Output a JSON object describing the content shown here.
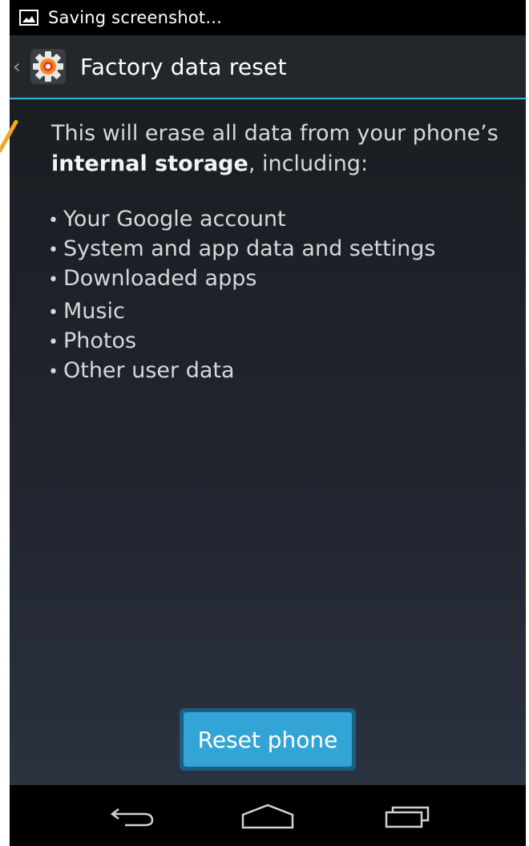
{
  "status_bar": {
    "text": "Saving screenshot...",
    "icon": "image-icon"
  },
  "action_bar": {
    "back_icon": "chevron-left-icon",
    "app_icon": "settings-gear-icon",
    "title": "Factory data reset",
    "divider_color": "#33b5e5"
  },
  "content": {
    "intro_prefix": "This will erase all data from your phone’s ",
    "intro_bold": "internal storage",
    "intro_suffix": ", including:",
    "items": [
      "Your Google account",
      "System and app data and settings",
      "Downloaded apps",
      "Music",
      "Photos",
      "Other user data"
    ]
  },
  "button": {
    "label": "Reset phone",
    "color": "#33a4d6"
  },
  "nav_bar": {
    "back": "back-arrow-icon",
    "home": "home-icon",
    "recents": "recent-apps-icon"
  },
  "annotation_color": "#f0a824"
}
